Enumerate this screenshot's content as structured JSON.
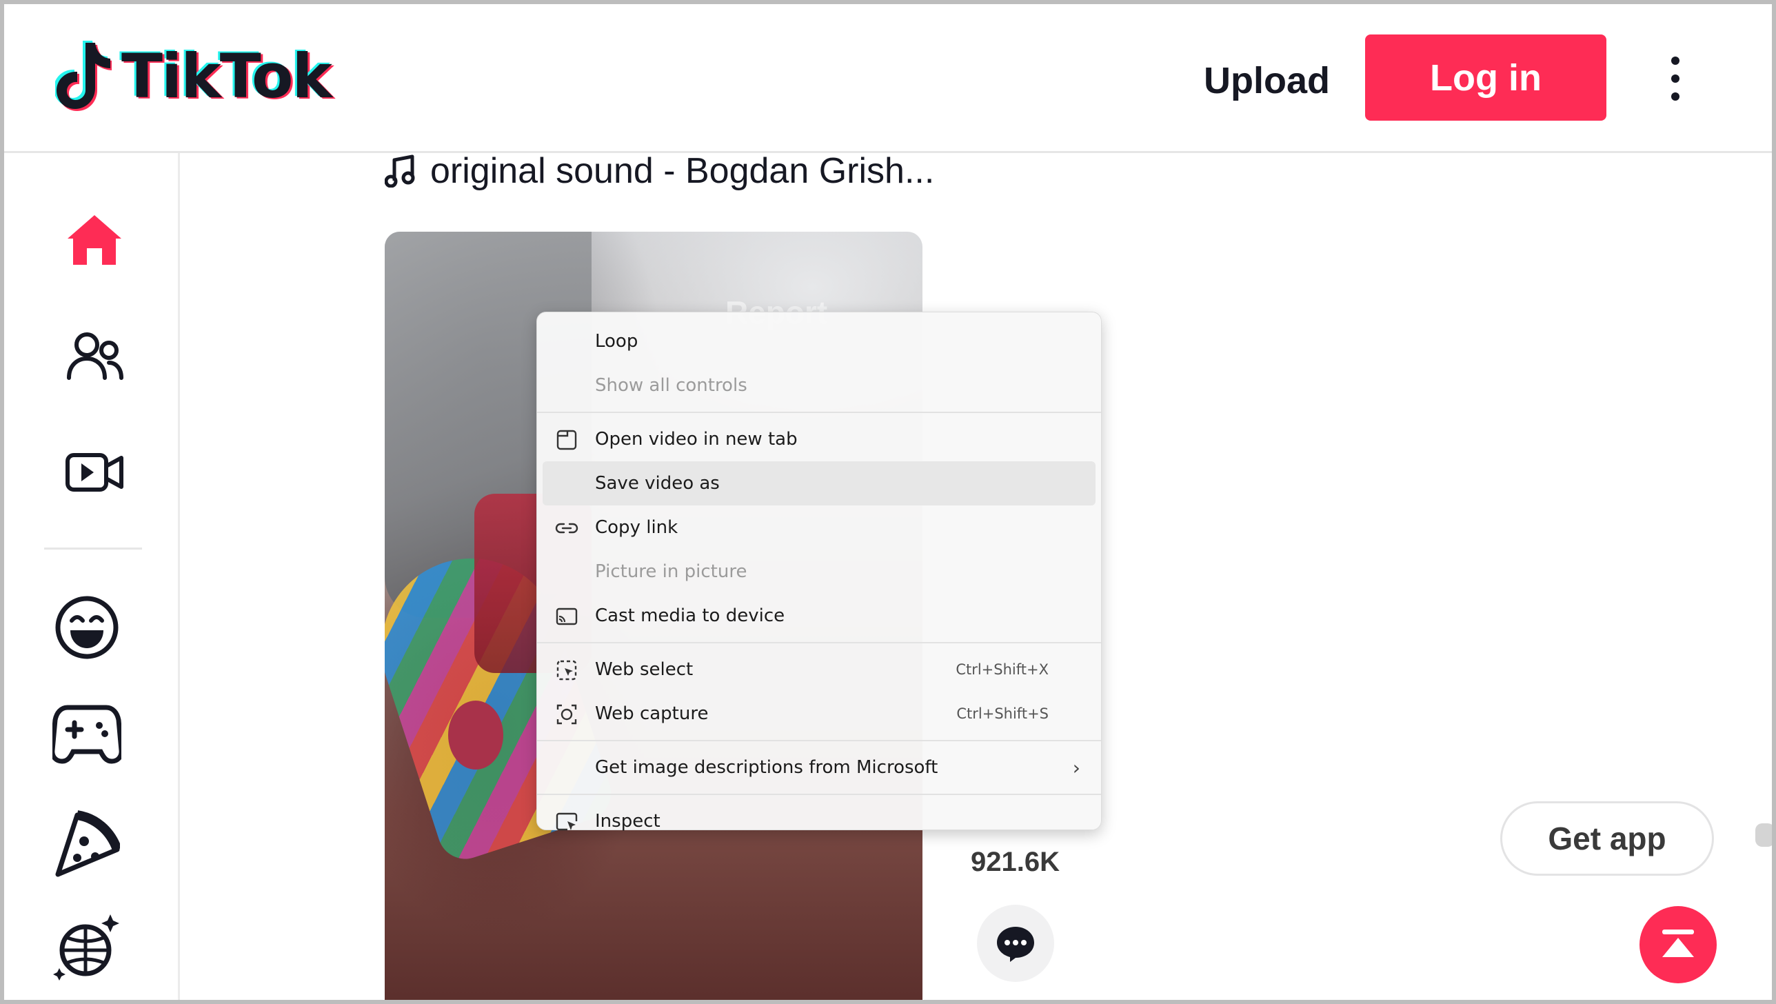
{
  "header": {
    "brand": "TikTok",
    "upload_label": "Upload",
    "login_label": "Log in"
  },
  "sidebar": {
    "items": [
      {
        "name": "home",
        "icon": "home-icon",
        "active": true
      },
      {
        "name": "following",
        "icon": "users-icon"
      },
      {
        "name": "live",
        "icon": "live-video-icon"
      },
      {
        "name": "comedy",
        "icon": "laughing-face-icon"
      },
      {
        "name": "gaming",
        "icon": "gamepad-icon"
      },
      {
        "name": "food",
        "icon": "pizza-icon"
      },
      {
        "name": "dance",
        "icon": "disco-ball-icon"
      }
    ]
  },
  "main": {
    "sound_label": "original sound - Bogdan Grish...",
    "report_ghost": "Report",
    "likes_count": "921.6K"
  },
  "floating": {
    "get_app_label": "Get app"
  },
  "context_menu": {
    "groups": [
      [
        {
          "label": "Loop",
          "icon": "",
          "disabled": false
        },
        {
          "label": "Show all controls",
          "icon": "",
          "disabled": true
        }
      ],
      [
        {
          "label": "Open video in new tab",
          "icon": "new-tab-icon",
          "disabled": false
        },
        {
          "label": "Save video as",
          "icon": "",
          "disabled": false,
          "highlighted": true
        },
        {
          "label": "Copy link",
          "icon": "link-icon",
          "disabled": false
        },
        {
          "label": "Picture in picture",
          "icon": "",
          "disabled": true
        },
        {
          "label": "Cast media to device",
          "icon": "cast-icon",
          "disabled": false
        }
      ],
      [
        {
          "label": "Web select",
          "icon": "web-select-icon",
          "shortcut": "Ctrl+Shift+X"
        },
        {
          "label": "Web capture",
          "icon": "web-capture-icon",
          "shortcut": "Ctrl+Shift+S"
        }
      ],
      [
        {
          "label": "Get image descriptions from Microsoft",
          "icon": "",
          "has_submenu": true
        }
      ],
      [
        {
          "label": "Inspect",
          "icon": "inspect-icon"
        }
      ]
    ]
  },
  "colors": {
    "brand_red": "#fe2c55",
    "text_dark": "#161823",
    "tiktok_cyan": "#25f4ee"
  }
}
